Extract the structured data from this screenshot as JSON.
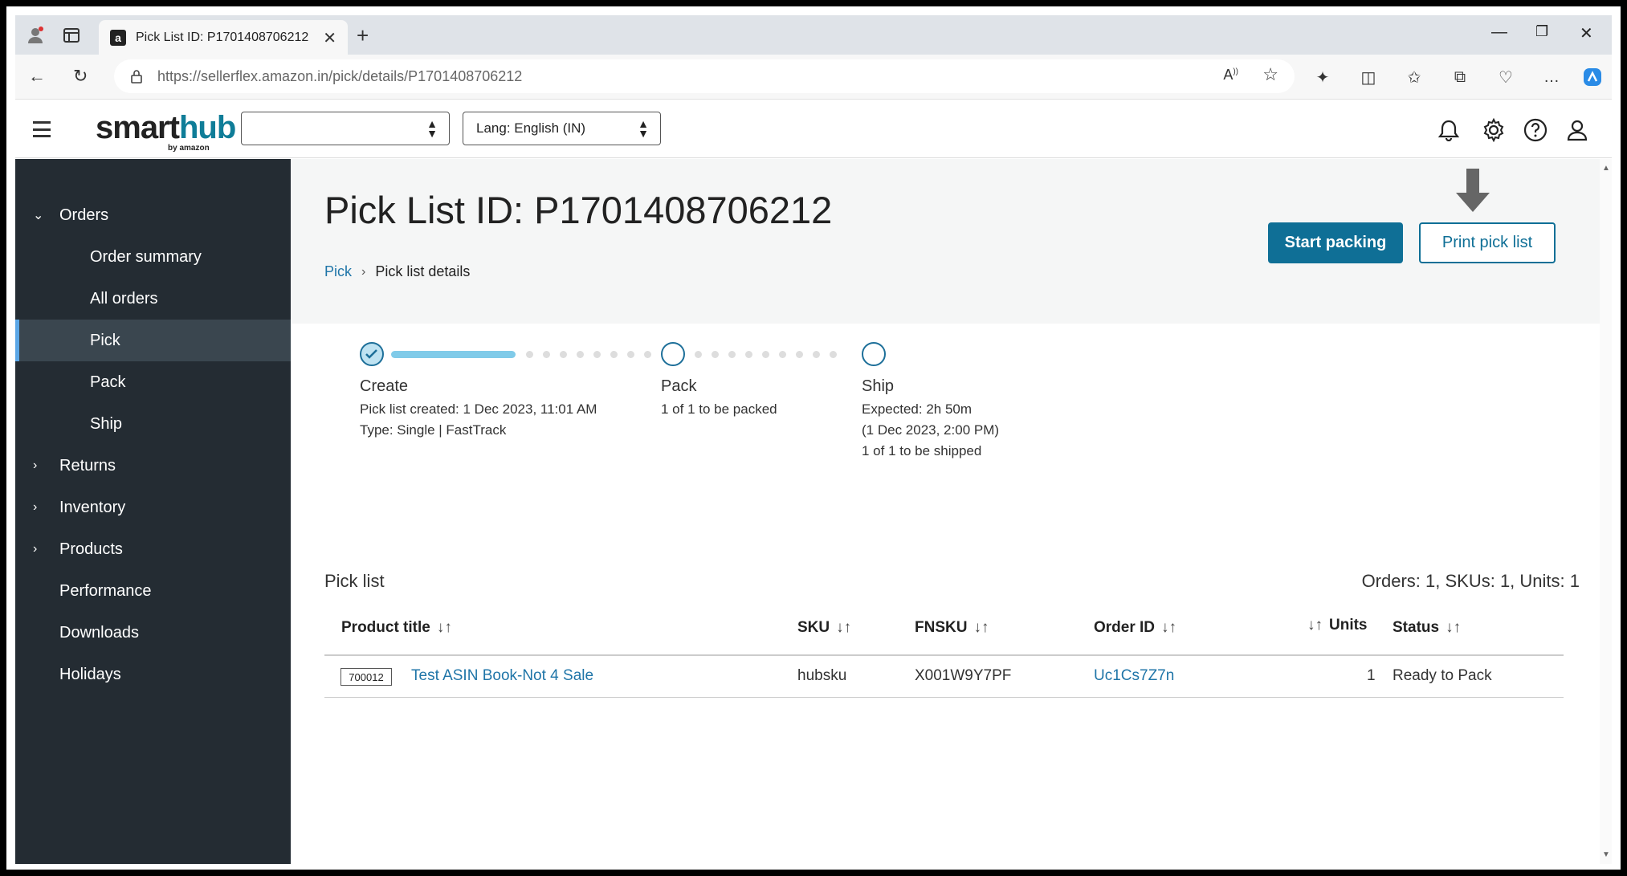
{
  "browser": {
    "tab_title": "Pick List ID: P1701408706212",
    "tab_favicon": "a",
    "url_host": "https://sellerflex.amazon.in",
    "url_path": "/pick/details/P1701408706212"
  },
  "header": {
    "logo_main": "smart",
    "logo_hub": "hub",
    "logo_sub": "by amazon",
    "store_select_value": "",
    "lang_select_value": "Lang: English (IN)"
  },
  "sidebar": {
    "items": [
      {
        "label": "Orders",
        "expanded": true
      },
      {
        "label": "Order summary"
      },
      {
        "label": "All orders"
      },
      {
        "label": "Pick",
        "active": true
      },
      {
        "label": "Pack"
      },
      {
        "label": "Ship"
      },
      {
        "label": "Returns",
        "expanded": false
      },
      {
        "label": "Inventory",
        "expanded": false
      },
      {
        "label": "Products",
        "expanded": false
      },
      {
        "label": "Performance"
      },
      {
        "label": "Downloads"
      },
      {
        "label": "Holidays"
      }
    ]
  },
  "main": {
    "title": "Pick List ID: P1701408706212",
    "breadcrumb": {
      "link": "Pick",
      "current": "Pick list details"
    },
    "start_packing_label": "Start packing",
    "print_pick_list_label": "Print pick list",
    "steps": [
      {
        "title": "Create",
        "lines": [
          "Pick list created: 1 Dec 2023, 11:01 AM",
          "Type: Single | FastTrack"
        ],
        "done": true
      },
      {
        "title": "Pack",
        "lines": [
          "1 of 1 to be packed"
        ],
        "done": false
      },
      {
        "title": "Ship",
        "lines": [
          "Expected: 2h 50m",
          "(1 Dec 2023, 2:00 PM)",
          "1 of 1 to be shipped"
        ],
        "done": false
      }
    ],
    "pick_list": {
      "label": "Pick list",
      "summary": "Orders: 1, SKUs: 1, Units: 1",
      "columns": [
        "Product title",
        "SKU",
        "FNSKU",
        "Order ID",
        "Units",
        "Status"
      ],
      "rows": [
        {
          "tag": "700012",
          "product_title": "Test ASIN Book-Not 4 Sale",
          "sku": "hubsku",
          "fnsku": "X001W9Y7PF",
          "order_id": "Uc1Cs7Z7n",
          "units": "1",
          "status": "Ready to Pack"
        }
      ]
    }
  },
  "colors": {
    "sidebar_bg": "#242c33",
    "accent": "#0f6f96",
    "link": "#1f75a8",
    "progress": "#80cbe9"
  }
}
